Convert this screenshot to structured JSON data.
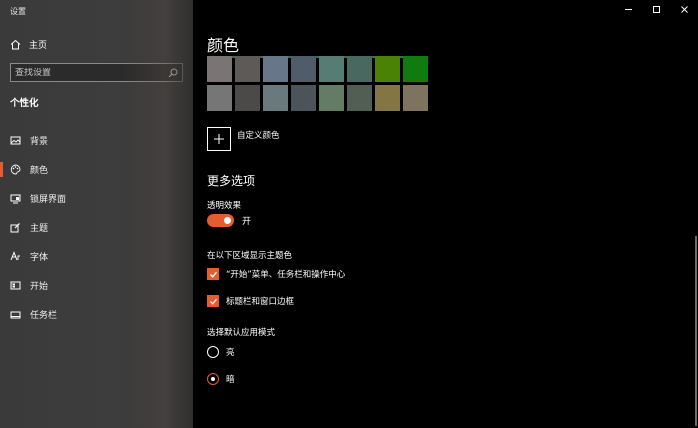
{
  "window": {
    "title": "设置"
  },
  "sidebar": {
    "home_label": "主页",
    "search_placeholder": "查找设置",
    "section_title": "个性化",
    "items": [
      {
        "label": "背景",
        "icon": "image-icon"
      },
      {
        "label": "颜色",
        "icon": "palette-icon",
        "active": true
      },
      {
        "label": "锁屏界面",
        "icon": "lock-screen-icon"
      },
      {
        "label": "主题",
        "icon": "theme-icon"
      },
      {
        "label": "字体",
        "icon": "font-icon"
      },
      {
        "label": "开始",
        "icon": "start-icon"
      },
      {
        "label": "任务栏",
        "icon": "taskbar-icon"
      }
    ]
  },
  "main": {
    "title": "颜色",
    "swatches": [
      "#7a7574",
      "#5d5a58",
      "#68768a",
      "#515c6b",
      "#567c73",
      "#486860",
      "#498205",
      "#107c10",
      "#767676",
      "#4c4a48",
      "#69797e",
      "#4a5459",
      "#647c64",
      "#525e54",
      "#847545",
      "#7e735f"
    ],
    "custom_color_label": "自定义颜色",
    "more_options_title": "更多选项",
    "transparency_label": "透明效果",
    "transparency_state": "开",
    "accent_surfaces_label": "在以下区域显示主题色",
    "accent_option_1": "“开始”菜单、任务栏和操作中心",
    "accent_option_2": "标题栏和窗口边框",
    "app_mode_label": "选择默认应用模式",
    "mode_light": "亮",
    "mode_dark": "暗"
  },
  "colors": {
    "accent": "#e35d2e"
  }
}
